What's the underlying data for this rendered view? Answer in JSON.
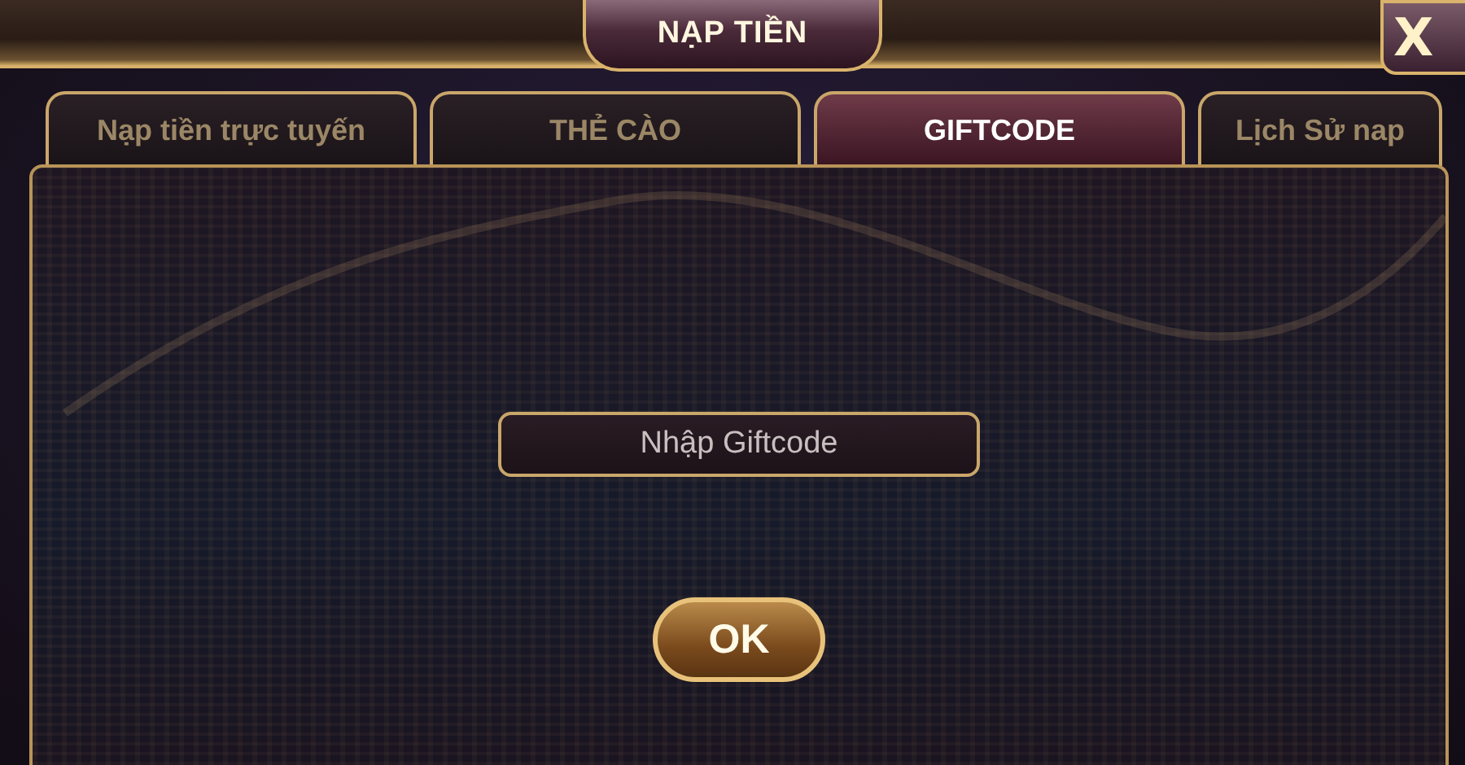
{
  "window": {
    "title": "NẠP TIỀN",
    "close": "X"
  },
  "tabs": [
    {
      "label": "Nạp tiền trực tuyến",
      "selected": false
    },
    {
      "label": "THẺ CÀO",
      "selected": false
    },
    {
      "label": "GIFTCODE",
      "selected": true
    },
    {
      "label": "Lịch Sử nap",
      "selected": false
    }
  ],
  "giftcode": {
    "placeholder": "Nhập Giftcode"
  },
  "buttons": [
    "OK"
  ]
}
